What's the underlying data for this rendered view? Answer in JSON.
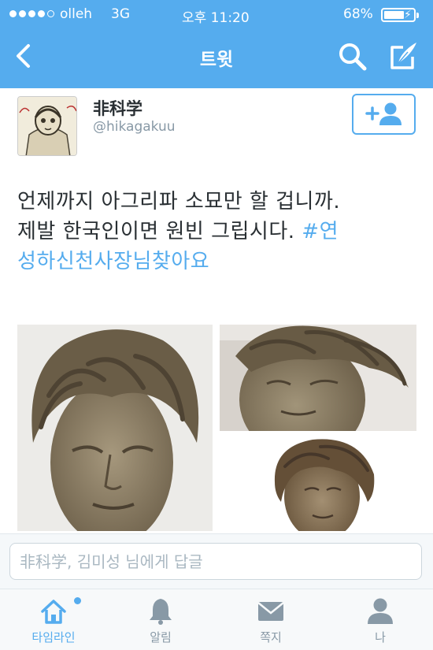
{
  "status_bar": {
    "carrier": "olleh",
    "network": "3G",
    "time": "오후 11:20",
    "battery_percent": "68%",
    "battery_level": 0.68,
    "signal_bars": 4
  },
  "nav": {
    "title": "트윗",
    "back_icon": "chevron-left-icon",
    "search_icon": "search-icon",
    "compose_icon": "compose-icon"
  },
  "tweet": {
    "display_name": "非科学",
    "handle": "@hikagakuu",
    "text_lines": [
      "언제까지 아그리파 소묘만 할 겁니까.",
      "제발 한국인이면 원빈 그립시다. "
    ],
    "hashtag_part1": "#연",
    "hashtag_part2": "성하신천사장님찾아요",
    "follow_icon": "add-user-icon",
    "photo_count": 3
  },
  "reply": {
    "placeholder": "非科学, 김미성 님에게 답글",
    "value": ""
  },
  "tabs": [
    {
      "label": "타임라인",
      "icon": "home-icon",
      "active": true,
      "has_notification": true
    },
    {
      "label": "알림",
      "icon": "bell-icon",
      "active": false
    },
    {
      "label": "쪽지",
      "icon": "envelope-icon",
      "active": false
    },
    {
      "label": "나",
      "icon": "person-icon",
      "active": false
    }
  ],
  "colors": {
    "brand": "#55acee",
    "text": "#292f33",
    "muted": "#8899a6"
  }
}
